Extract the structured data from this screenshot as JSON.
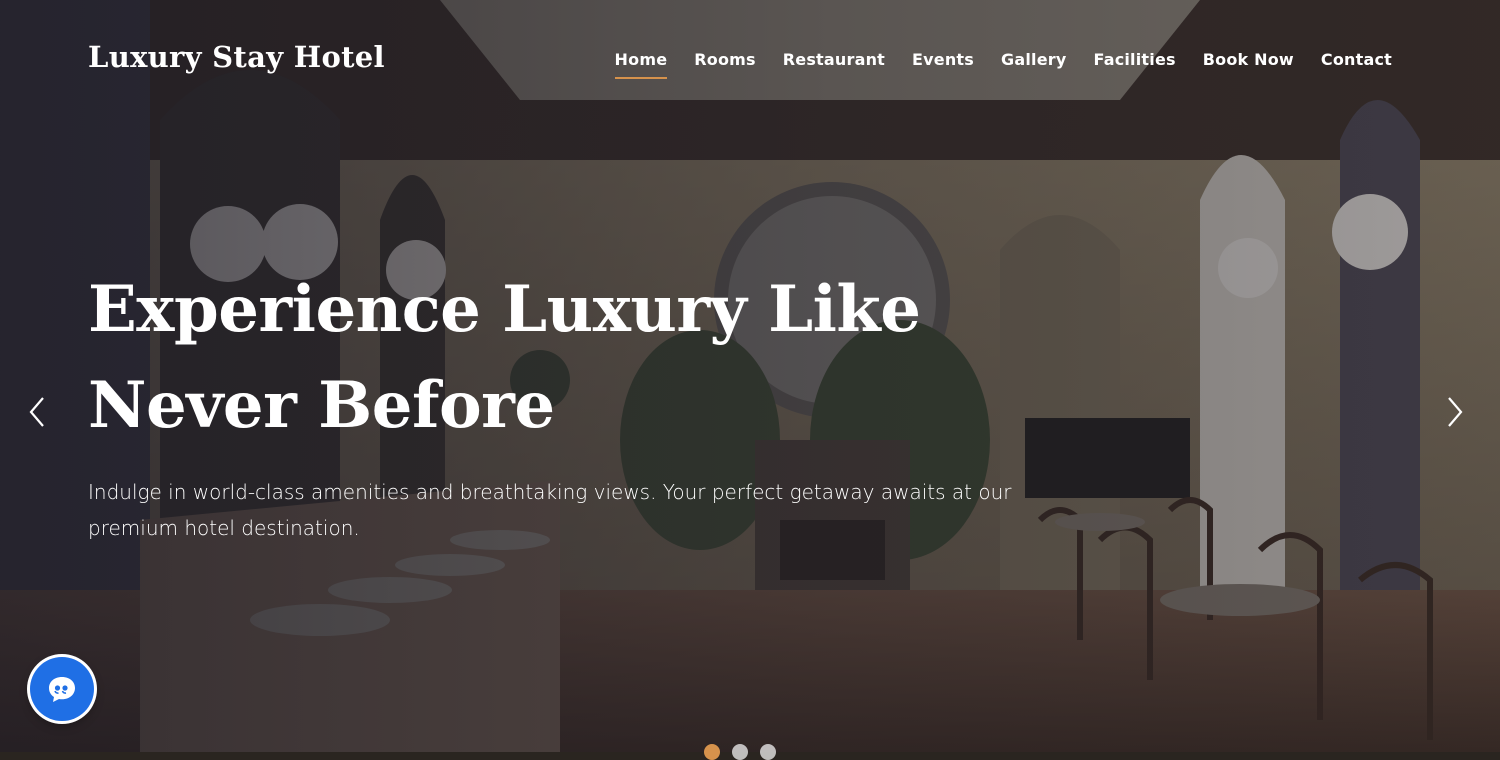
{
  "header": {
    "brand": "Luxury Stay Hotel",
    "nav": [
      "Home",
      "Rooms",
      "Restaurant",
      "Events",
      "Gallery",
      "Facilities",
      "Book Now",
      "Contact"
    ],
    "active_nav": "Home"
  },
  "hero": {
    "title": "Experience Luxury Like Never Before",
    "subtitle": "Indulge in world-class amenities and breathtaking views. Your perfect getaway awaits at our premium hotel destination."
  },
  "carousel": {
    "slide_count": 3,
    "active_slide": 1,
    "prev_icon": "chevron-left-icon",
    "next_icon": "chevron-right-icon"
  },
  "chat": {
    "icon": "chat-quote-icon"
  },
  "colors": {
    "accent": "#d6924c",
    "chat_button": "#1f6fe5",
    "text": "#ffffff"
  }
}
